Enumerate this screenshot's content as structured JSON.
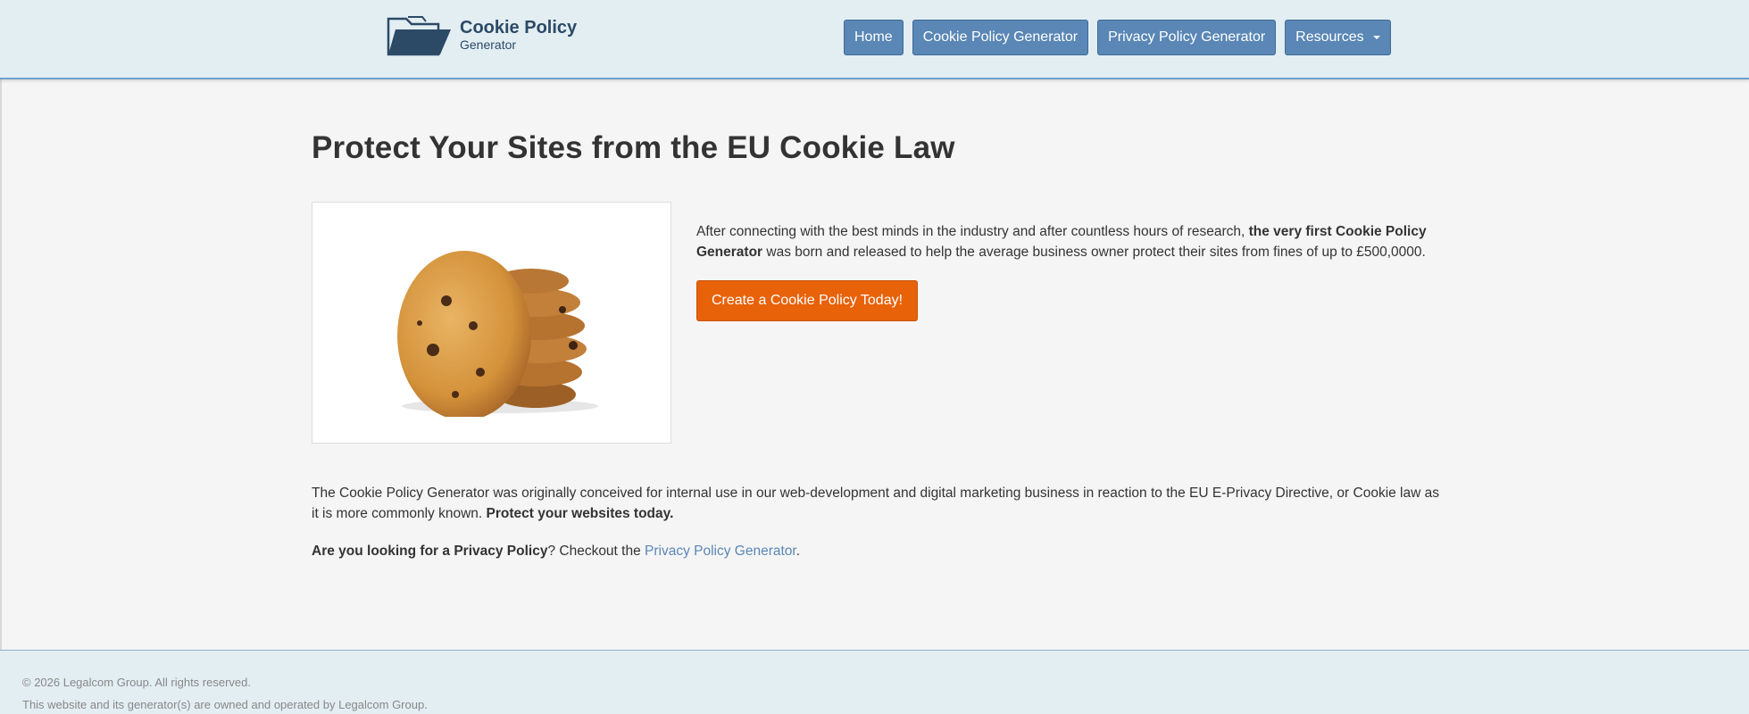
{
  "header": {
    "logo": {
      "title": "Cookie Policy",
      "subtitle": "Generator",
      "icon": "folder-icon"
    },
    "nav": [
      {
        "label": "Home"
      },
      {
        "label": "Cookie Policy Generator"
      },
      {
        "label": "Privacy Policy Generator"
      },
      {
        "label": "Resources",
        "dropdown": true
      }
    ]
  },
  "main": {
    "title": "Protect Your Sites from the EU Cookie Law",
    "image": {
      "subject": "cookie-stack-image"
    },
    "intro": {
      "text_before": "After connecting with the best minds in the industry and after countless hours of research, ",
      "bold": "the very first Cookie Policy Generator",
      "text_after": " was born and released to help the average business owner protect their sites from fines of up to £500,0000."
    },
    "cta_label": "Create a Cookie Policy Today!",
    "paragraph1": {
      "text": "The Cookie Policy Generator was originally conceived for internal use in our web-development and digital marketing business in reaction to the EU E-Privacy Directive, or Cookie law as it is more commonly known. ",
      "bold": "Protect your websites today."
    },
    "paragraph2": {
      "bold": "Are you looking for a Privacy Policy",
      "text": "? Checkout the ",
      "link": "Privacy Policy Generator",
      "end": "."
    }
  },
  "footer": {
    "copyright": "© 2026 Legalcom Group. All rights reserved.",
    "ownership": "This website and its generator(s) are owned and operated by Legalcom Group."
  },
  "colors": {
    "header_bg": "#e3eef3",
    "nav_button": "#5a87b5",
    "cta": "#e8620a",
    "link": "#5a87b5"
  }
}
